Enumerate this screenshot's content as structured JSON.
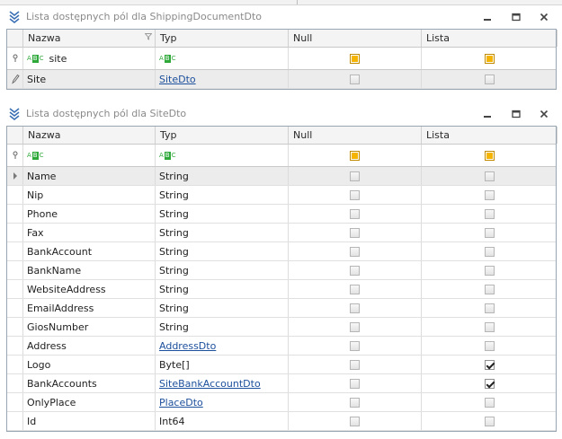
{
  "panel_top": {
    "title": "Lista dostępnych pól dla ShippingDocumentDto",
    "columns": {
      "name": "Nazwa",
      "type": "Typ",
      "null": "Null",
      "list": "Lista"
    },
    "filter": {
      "name_text": "site",
      "null_state": "indeterminate",
      "list_state": "indeterminate"
    },
    "rows": [
      {
        "name": "Site",
        "type": "SiteDto",
        "type_is_link": true,
        "null_checked": false,
        "list_checked": false,
        "row_icon": "pencil-icon"
      }
    ]
  },
  "panel_bottom": {
    "title": "Lista dostępnych pól dla SiteDto",
    "columns": {
      "name": "Nazwa",
      "type": "Typ",
      "null": "Null",
      "list": "Lista"
    },
    "filter": {
      "name_text": "",
      "null_state": "indeterminate",
      "list_state": "indeterminate"
    },
    "rows": [
      {
        "name": "Name",
        "type": "String",
        "type_is_link": false,
        "null_checked": false,
        "list_checked": false
      },
      {
        "name": "Nip",
        "type": "String",
        "type_is_link": false,
        "null_checked": false,
        "list_checked": false
      },
      {
        "name": "Phone",
        "type": "String",
        "type_is_link": false,
        "null_checked": false,
        "list_checked": false
      },
      {
        "name": "Fax",
        "type": "String",
        "type_is_link": false,
        "null_checked": false,
        "list_checked": false
      },
      {
        "name": "BankAccount",
        "type": "String",
        "type_is_link": false,
        "null_checked": false,
        "list_checked": false
      },
      {
        "name": "BankName",
        "type": "String",
        "type_is_link": false,
        "null_checked": false,
        "list_checked": false
      },
      {
        "name": "WebsiteAddress",
        "type": "String",
        "type_is_link": false,
        "null_checked": false,
        "list_checked": false
      },
      {
        "name": "EmailAddress",
        "type": "String",
        "type_is_link": false,
        "null_checked": false,
        "list_checked": false
      },
      {
        "name": "GiosNumber",
        "type": "String",
        "type_is_link": false,
        "null_checked": false,
        "list_checked": false
      },
      {
        "name": "Address",
        "type": "AddressDto",
        "type_is_link": true,
        "null_checked": false,
        "list_checked": false
      },
      {
        "name": "Logo",
        "type": "Byte[]",
        "type_is_link": false,
        "null_checked": false,
        "list_checked": true
      },
      {
        "name": "BankAccounts",
        "type": "SiteBankAccountDto",
        "type_is_link": true,
        "null_checked": false,
        "list_checked": true
      },
      {
        "name": "OnlyPlace",
        "type": "PlaceDto",
        "type_is_link": true,
        "null_checked": false,
        "list_checked": false
      },
      {
        "name": "Id",
        "type": "Int64",
        "type_is_link": false,
        "null_checked": false,
        "list_checked": false
      }
    ]
  },
  "colors": {
    "accent_link": "#1c4f9c",
    "indeterminate": "#f4b400",
    "abc_icon": "#2fa83a",
    "grid_border": "#9aa5b3"
  }
}
